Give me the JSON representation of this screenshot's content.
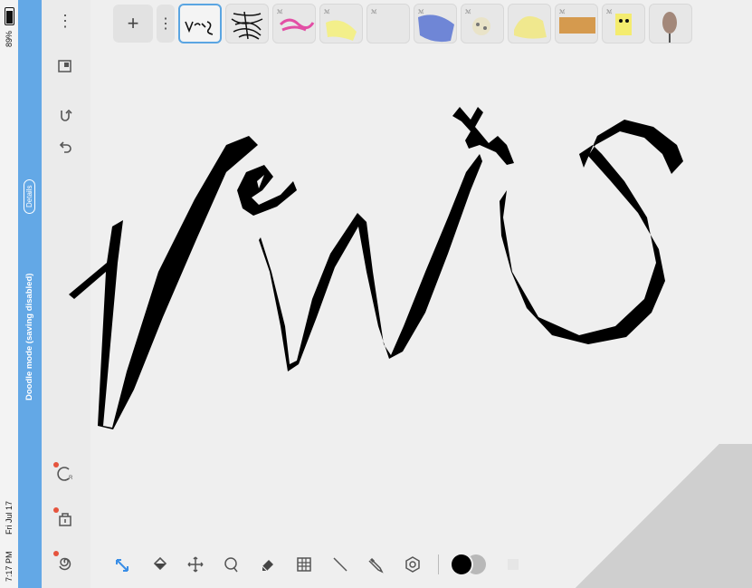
{
  "status": {
    "time": "7:17 PM",
    "date": "Fri Jul 17",
    "battery": "89%"
  },
  "banner": {
    "text": "Doodle mode (saving disabled)",
    "details_label": "Details"
  },
  "toolbar_top": {
    "add_label": "+",
    "more_label": "⋮"
  },
  "left_rail": {
    "menu_label": "⋮"
  },
  "palette": {
    "primary_color": "#000000",
    "secondary_color": "#b8b8b8"
  },
  "icons": {
    "add": "plus-icon",
    "undo": "undo-icon",
    "redo": "redo-icon",
    "layers": "layers-icon"
  },
  "thumbnails": [
    {
      "name": "page-1",
      "selected": true
    },
    {
      "name": "page-2",
      "selected": false
    },
    {
      "name": "page-3",
      "selected": false
    },
    {
      "name": "page-4",
      "selected": false
    },
    {
      "name": "page-5",
      "selected": false
    },
    {
      "name": "page-6",
      "selected": false
    },
    {
      "name": "page-7",
      "selected": false
    },
    {
      "name": "page-8",
      "selected": false
    },
    {
      "name": "page-9",
      "selected": false
    },
    {
      "name": "page-10",
      "selected": false
    },
    {
      "name": "page-11",
      "selected": false
    }
  ]
}
